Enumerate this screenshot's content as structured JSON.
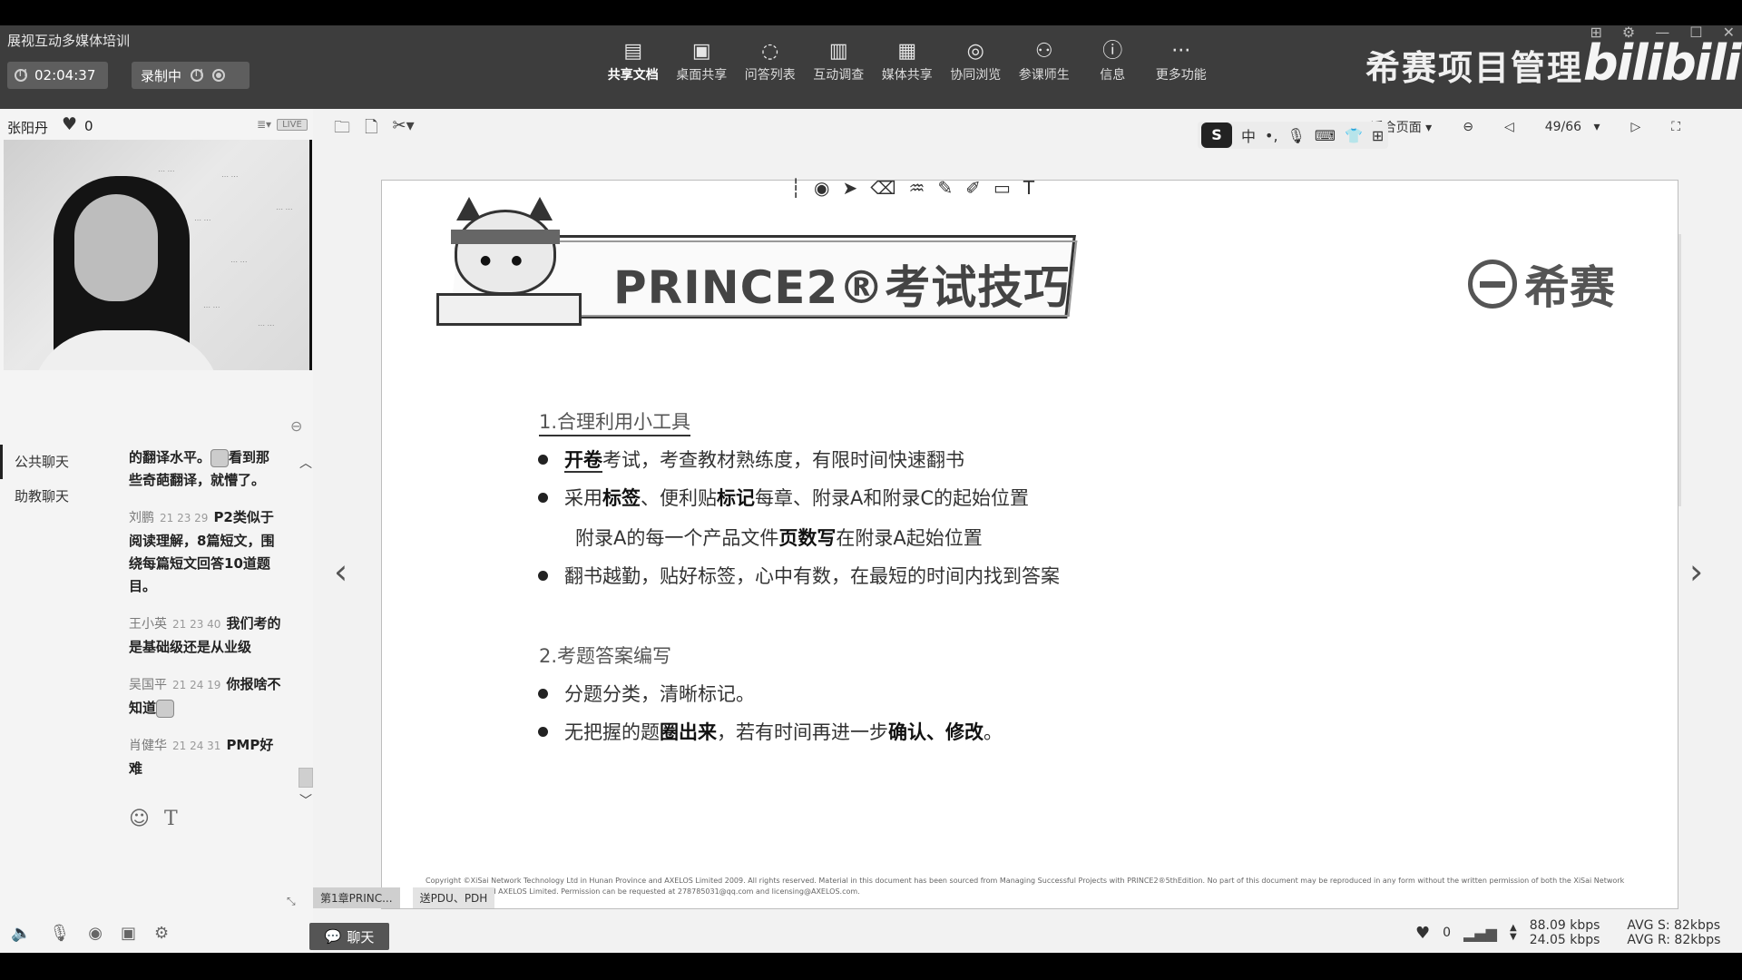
{
  "app": {
    "title": "展视互动多媒体培训",
    "timer": "02:04:37",
    "recording_label": "录制中",
    "brand": "希赛项目管理",
    "bili_logo": "bilibili"
  },
  "toolbar": [
    {
      "icon": "document-icon",
      "glyph": "▤",
      "label": "共享文档",
      "active": true
    },
    {
      "icon": "desktop-icon",
      "glyph": "▣",
      "label": "桌面共享"
    },
    {
      "icon": "qa-icon",
      "glyph": "◌",
      "label": "问答列表"
    },
    {
      "icon": "bar-chart-icon",
      "glyph": "▥",
      "label": "互动调查"
    },
    {
      "icon": "film-icon",
      "glyph": "▦",
      "label": "媒体共享"
    },
    {
      "icon": "compass-icon",
      "glyph": "◎",
      "label": "协同浏览"
    },
    {
      "icon": "users-icon",
      "glyph": "⚇",
      "label": "参课师生"
    },
    {
      "icon": "info-icon",
      "glyph": "ⓘ",
      "label": "信息"
    },
    {
      "icon": "more-icon",
      "glyph": "···",
      "label": "更多功能"
    }
  ],
  "presenter": {
    "name": "张阳丹",
    "likes": "0",
    "live": "LIVE"
  },
  "chat": {
    "tabs": [
      "公共聊天",
      "助教聊天"
    ],
    "messages": [
      {
        "who": "",
        "time": "",
        "text": "的翻译水平。",
        "tail": "看到那些奇葩翻译，就懵了。",
        "emoji": true
      },
      {
        "who": "刘鹏",
        "time": "21 23 29",
        "text": "P2类似于阅读理解，8篇短文，围绕每篇短文回答10道题目。"
      },
      {
        "who": "王小英",
        "time": "21 23 40",
        "text": "我们考的是基础级还是从业级"
      },
      {
        "who": "吴国平",
        "time": "21 24 19",
        "text": "你报啥不知道",
        "emoji": true
      },
      {
        "who": "肖健华",
        "time": "21 24 31",
        "text": "PMP好难"
      }
    ]
  },
  "page_control": {
    "fit_label": "适合页面",
    "page": "49/66"
  },
  "ime": {
    "logo": "S",
    "lang": "中"
  },
  "slide": {
    "title": "PRINCE2®考试技巧",
    "logo_text": "希赛",
    "section1": "1.合理利用小工具",
    "b1_bold": "开卷",
    "b1_rest": "考试，考查教材熟练度，有限时间快速翻书",
    "b2_pre": "采用",
    "b2_bold1": "标签",
    "b2_mid": "、便利贴",
    "b2_bold2": "标记",
    "b2_rest": "每章、附录A和附录C的起始位置",
    "b2_line2_pre": "附录A的每一个产品文件",
    "b2_line2_bold": "页数写",
    "b2_line2_rest": "在附录A起始位置",
    "b3": "翻书越勤，贴好标签，心中有数，在最短的时间内找到答案",
    "section2": "2.考题答案编写",
    "b4": "分题分类，清晰标记。",
    "b5_pre": "无把握的题",
    "b5_bold1": "圈出来",
    "b5_mid": "，若有时间再进一步",
    "b5_bold2": "确认、修改",
    "b5_end": "。",
    "copyright": "Copyright ©XiSai Network Technology Ltd in Hunan Province and AXELOS Limited 2009. All rights reserved. Material in this document has been sourced from Managing Successful Projects with PRINCE2®5thEdition. No part of this document may be reproduced in any form without the written permission of both the XiSai Network Technology Ltd and AXELOS Limited. Permission can be requested at 278785031@qq.com and licensing@AXELOS.com."
  },
  "doc_tabs": [
    "第1章PRINC...",
    "送PDU、PDH"
  ],
  "bottom": {
    "chat_button": "聊天",
    "likes": "0",
    "net_up": "88.09 kbps",
    "net_down": "24.05 kbps",
    "avg_s": "AVG S: 82kbps",
    "avg_r": "AVG R: 82kbps"
  }
}
